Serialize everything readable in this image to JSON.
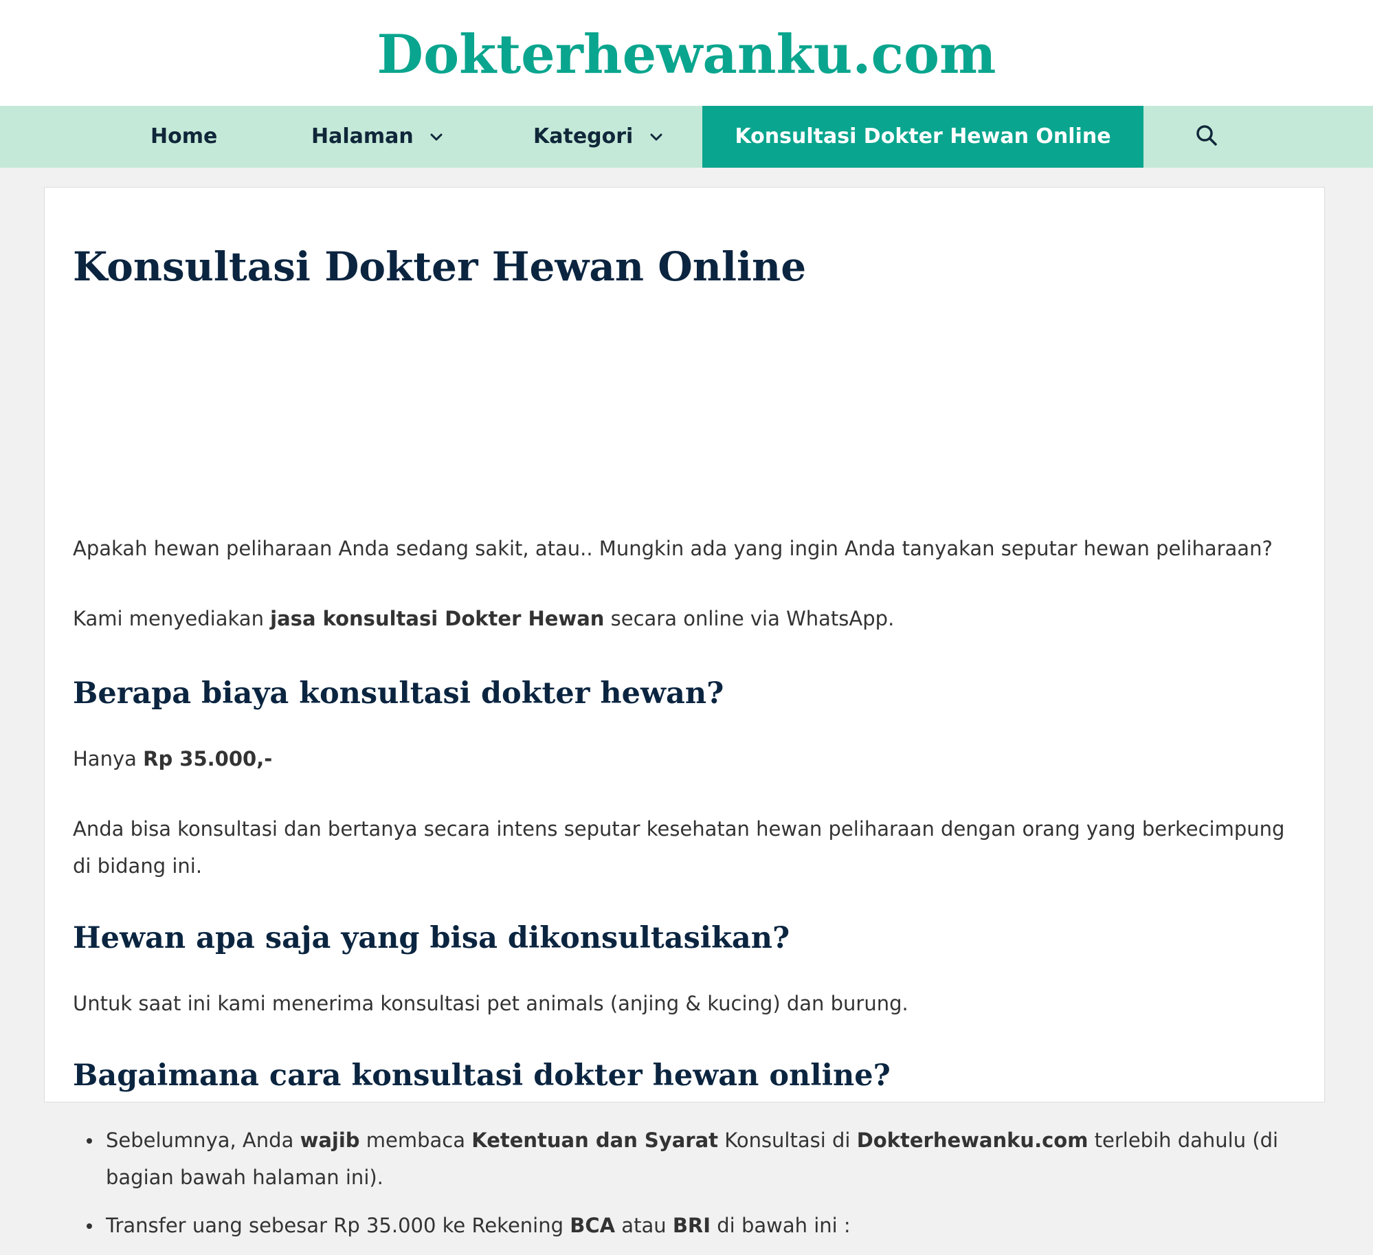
{
  "site": {
    "title": "Dokterhewanku.com"
  },
  "nav": {
    "home": "Home",
    "halaman": "Halaman",
    "kategori": "Kategori",
    "active": "Konsultasi Dokter Hewan Online"
  },
  "colors": {
    "brand": "#0aa58e",
    "nav_bg": "#c5e9d8",
    "heading": "#0b2540",
    "text": "#333333",
    "page_bg": "#f1f1f1"
  },
  "icons": {
    "dropdown": "chevron-down-icon",
    "search": "search-icon",
    "bullet": "bullet-icon"
  },
  "content": {
    "title": "Konsultasi Dokter Hewan Online",
    "p1": "Apakah hewan peliharaan Anda sedang sakit, atau.. Mungkin ada yang ingin Anda tanyakan seputar hewan peliharaan?",
    "p2_a": "Kami menyediakan ",
    "p2_b": "jasa konsultasi Dokter Hewan",
    "p2_c": " secara online via WhatsApp.",
    "h2_1": "Berapa biaya konsultasi dokter hewan?",
    "p3_a": "Hanya ",
    "p3_b": "Rp 35.000,-",
    "p4": "Anda bisa konsultasi dan bertanya secara intens seputar kesehatan hewan peliharaan dengan orang yang berkecimpung di bidang ini.",
    "h2_2": "Hewan apa saja yang bisa dikonsultasikan?",
    "p5": "Untuk saat ini kami menerima konsultasi pet animals (anjing & kucing) dan burung.",
    "h2_3": "Bagaimana cara konsultasi dokter hewan online?",
    "b1_a": "Sebelumnya, Anda ",
    "b1_b": "wajib",
    "b1_c": " membaca ",
    "b1_d": "Ketentuan dan Syarat",
    "b1_e": " Konsultasi di ",
    "b1_f": "Dokterhewanku.com",
    "b1_g": " terlebih dahulu (di bagian bawah halaman ini).",
    "b2_a": "Transfer uang sebesar Rp 35.000 ke Rekening ",
    "b2_b": "BCA",
    "b2_c": " atau ",
    "b2_d": "BRI",
    "b2_e": " di bawah ini :"
  }
}
